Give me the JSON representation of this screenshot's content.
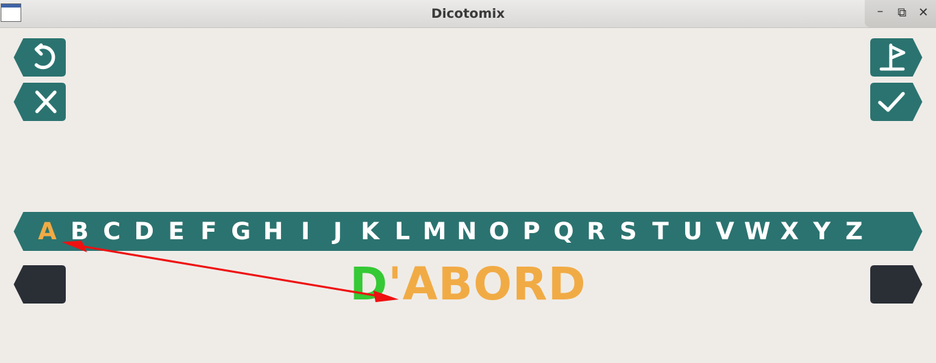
{
  "window": {
    "title": "Dicotomix",
    "controls": {
      "minimize": "–",
      "maximize": "⧉",
      "close": "✕"
    }
  },
  "left_buttons": [
    {
      "icon": "undo-icon"
    },
    {
      "icon": "close-icon"
    },
    {
      "icon": "none"
    }
  ],
  "right_buttons": [
    {
      "icon": "flag-icon"
    },
    {
      "icon": "check-icon"
    },
    {
      "icon": "none"
    }
  ],
  "alphabet": {
    "letters": [
      "A",
      "B",
      "C",
      "D",
      "E",
      "F",
      "G",
      "H",
      "I",
      "J",
      "K",
      "L",
      "M",
      "N",
      "O",
      "P",
      "Q",
      "R",
      "S",
      "T",
      "U",
      "V",
      "W",
      "X",
      "Y",
      "Z"
    ],
    "active": "A"
  },
  "word": {
    "highlighted": "D",
    "rest": "'ABORD"
  },
  "colors": {
    "teal": "#2b7370",
    "dark": "#2a2e35",
    "highlight_orange": "#f1ab45",
    "highlight_green": "#35c935",
    "arrow": "#ee1111",
    "background": "#efece8"
  }
}
